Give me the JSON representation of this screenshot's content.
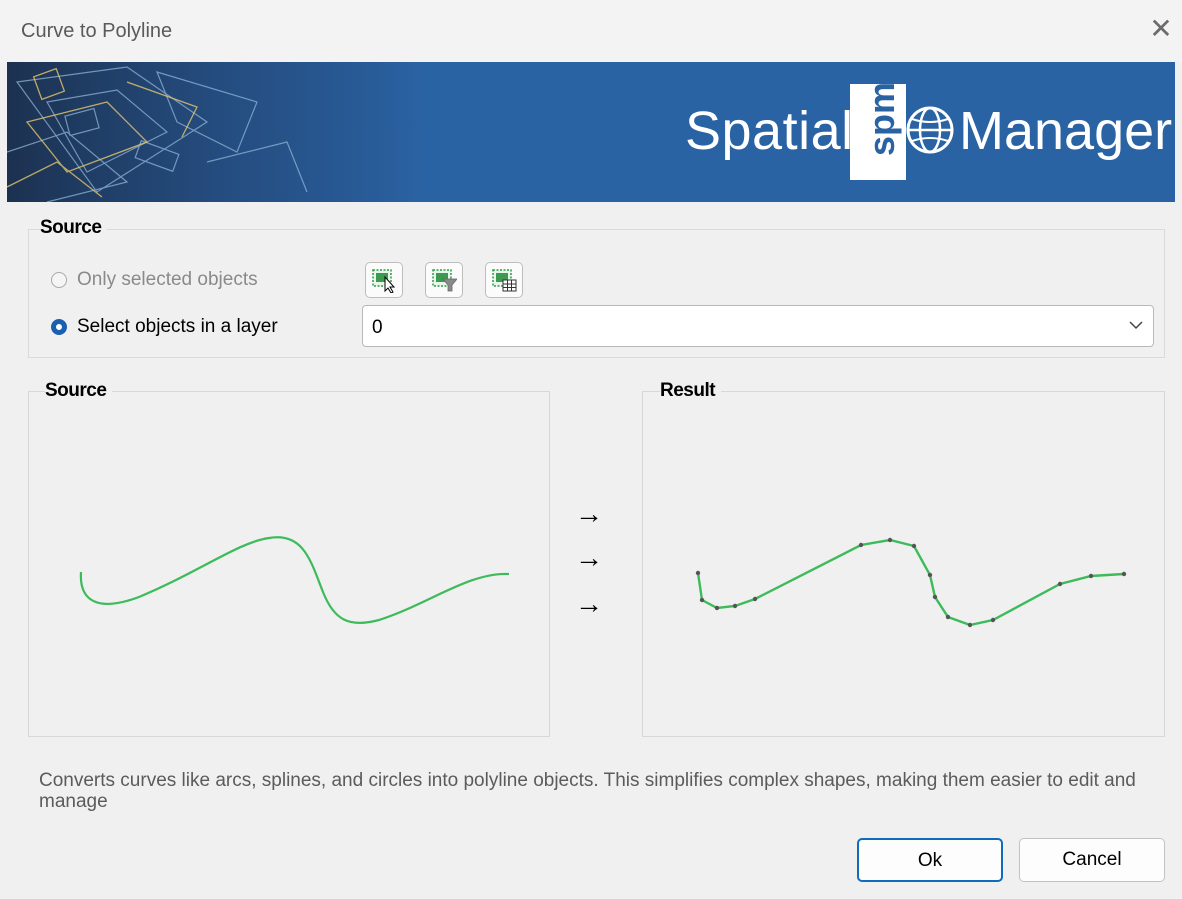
{
  "window": {
    "title": "Curve to Polyline",
    "close_icon": "close-icon"
  },
  "banner": {
    "brand_left": "Spatial",
    "brand_box": "spm",
    "brand_right": "Manager",
    "accent": "#2a63a4"
  },
  "source_group": {
    "label": "Source",
    "options": [
      {
        "label": "Only selected objects",
        "checked": false,
        "enabled": false
      },
      {
        "label": "Select objects in a layer",
        "checked": true,
        "enabled": true
      }
    ],
    "tool_buttons": [
      "select-objects-icon",
      "filter-objects-icon",
      "select-by-table-icon"
    ],
    "layer": {
      "value": "0"
    }
  },
  "preview": {
    "source_label": "Source",
    "result_label": "Result",
    "arrows": [
      "→",
      "→",
      "→"
    ],
    "curve_color": "#3dbb5a"
  },
  "description": "Converts curves like arcs, splines, and circles into polyline objects. This simplifies complex shapes, making them easier to edit and manage",
  "buttons": {
    "ok": "Ok",
    "cancel": "Cancel"
  }
}
